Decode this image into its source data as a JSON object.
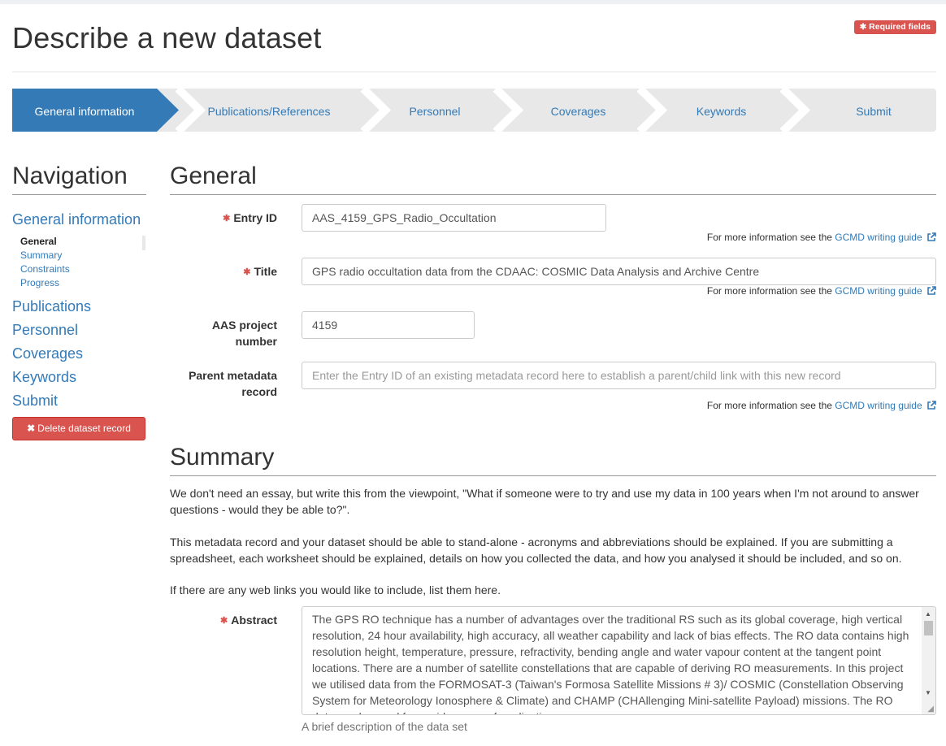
{
  "page": {
    "title": "Describe a new dataset",
    "required_badge": "Required fields"
  },
  "wizard": {
    "steps": [
      {
        "label": "General information",
        "active": true
      },
      {
        "label": "Publications/References",
        "active": false
      },
      {
        "label": "Personnel",
        "active": false
      },
      {
        "label": "Coverages",
        "active": false
      },
      {
        "label": "Keywords",
        "active": false
      },
      {
        "label": "Submit",
        "active": false
      }
    ]
  },
  "navigation": {
    "heading": "Navigation",
    "general_link": "General information",
    "sub_items": [
      "General",
      "Summary",
      "Constraints",
      "Progress"
    ],
    "links": [
      "Publications",
      "Personnel",
      "Coverages",
      "Keywords",
      "Submit"
    ],
    "delete_button": "Delete dataset record"
  },
  "general": {
    "heading": "General",
    "entry_id": {
      "label": "Entry ID",
      "value": "AAS_4159_GPS_Radio_Occultation",
      "required": true
    },
    "title": {
      "label": "Title",
      "value": "GPS radio occultation data from the CDAAC: COSMIC Data Analysis and Archive Centre",
      "required": true
    },
    "project_number": {
      "label_line1": "AAS project",
      "label_line2": "number",
      "value": "4159"
    },
    "parent_record": {
      "label_line1": "Parent metadata",
      "label_line2": "record",
      "placeholder": "Enter the Entry ID of an existing metadata record here to establish a parent/child link with this new record"
    },
    "help_prefix": "For more information see the",
    "help_link": "GCMD writing guide"
  },
  "summary": {
    "heading": "Summary",
    "paragraphs": [
      "We don't need an essay, but write this from the viewpoint, \"What if someone were to try and use my data in 100 years when I'm not around to answer questions - would they be able to?\".",
      "This metadata record and your dataset should be able to stand-alone - acronyms and abbreviations should be explained. If you are submitting a spreadsheet, each worksheet should be explained, details on how you collected the data, and how you analysed it should be included, and so on.",
      "If there are any web links you would like to include, list them here."
    ],
    "abstract": {
      "label": "Abstract",
      "required": true,
      "value": "The GPS RO technique has a number of advantages over the traditional RS such as its global coverage, high vertical resolution, 24 hour availability, high accuracy, all weather capability and lack of bias effects.  The RO data contains high resolution height, temperature, pressure, refractivity, bending angle and water vapour content at the tangent point locations.  There are a number of satellite constellations that are capable of deriving RO measurements. In this project we utilised data from the FORMOSAT-3 (Taiwan's Formosa Satellite Missions # 3)/ COSMIC (Constellation Observing System for Meteorology Ionosphere & Climate) and CHAMP (CHAllenging Mini-satellite Payload) missions. The RO data can be used for a wide range of applications.",
      "help": "A brief description of the data set"
    }
  },
  "colors": {
    "primary": "#337ab7",
    "danger": "#d9534f",
    "wizard_inactive": "#e8e8e8"
  }
}
